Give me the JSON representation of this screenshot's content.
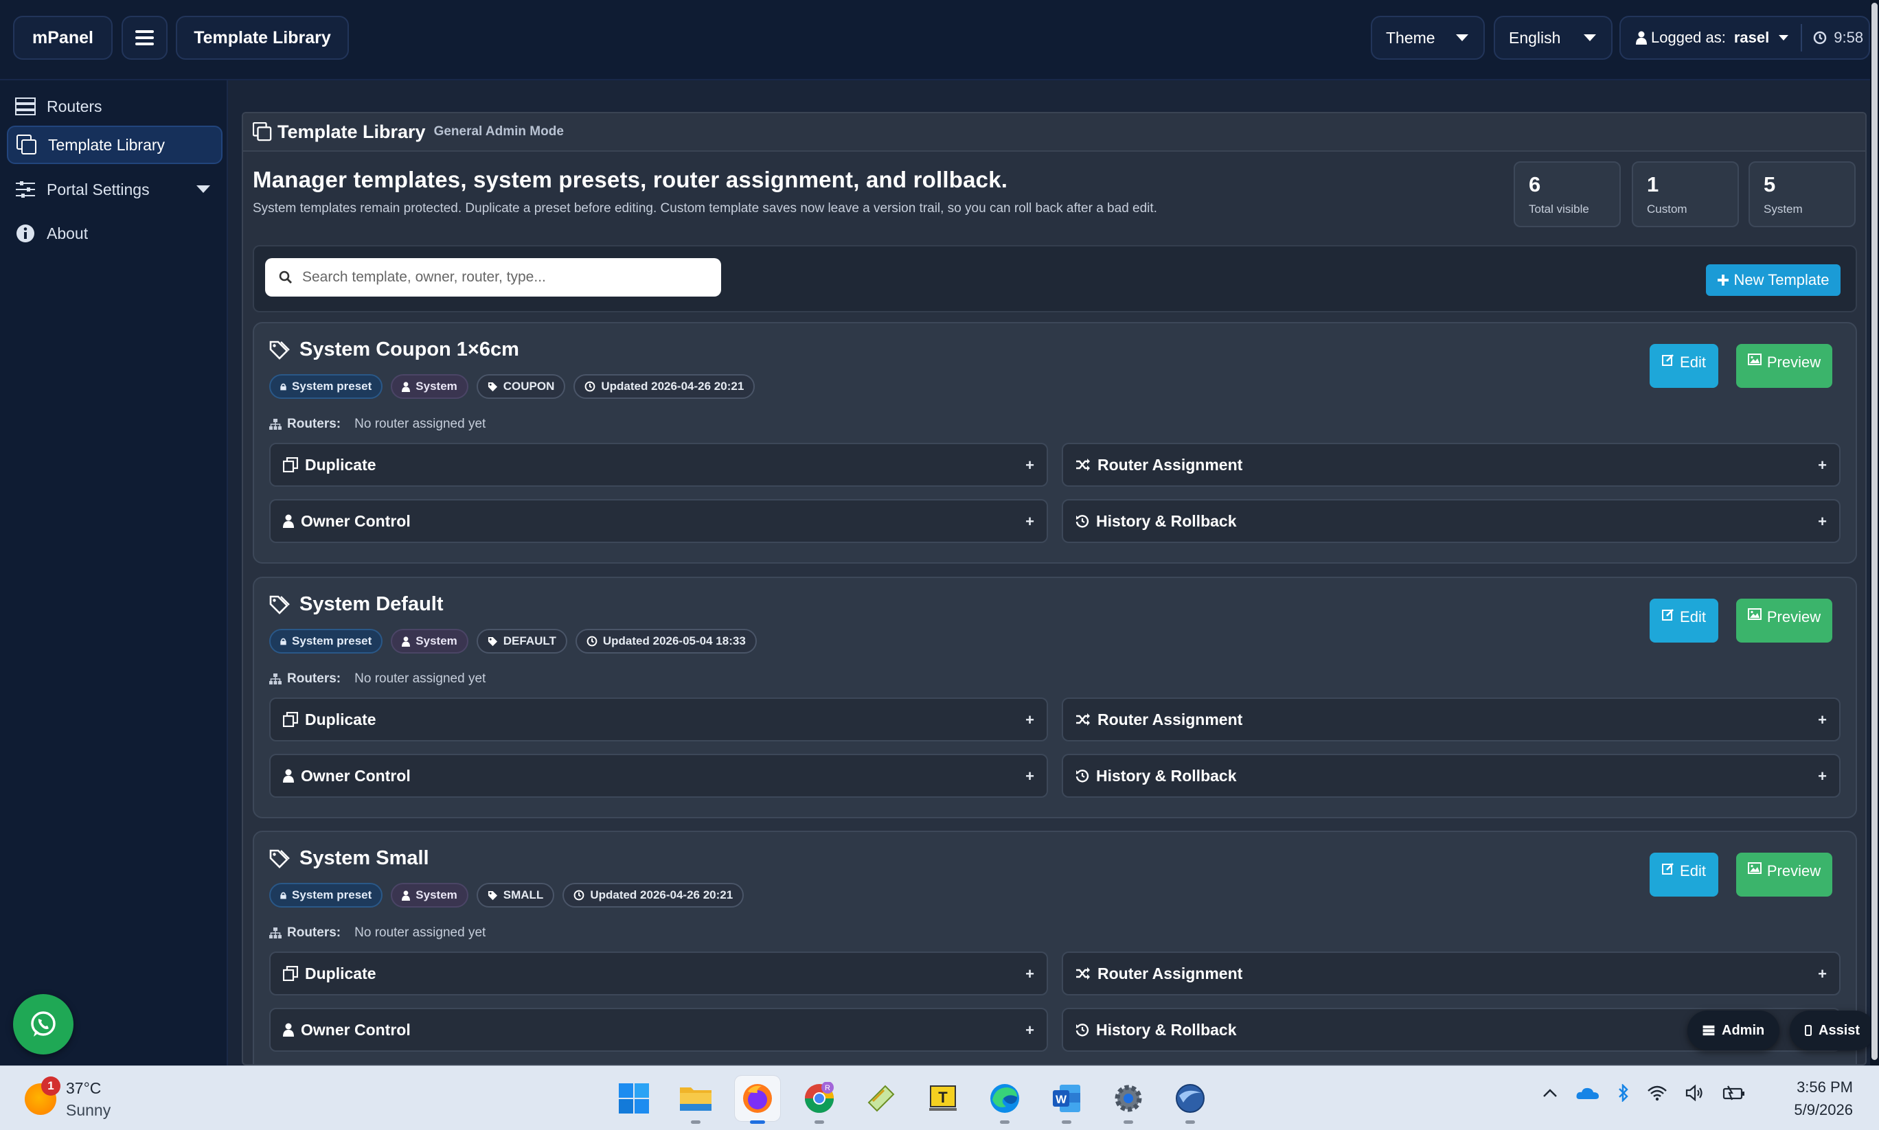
{
  "topbar": {
    "brand": "mPanel",
    "breadcrumb": "Template Library",
    "theme_label": "Theme",
    "language_label": "English",
    "logged_prefix": "Logged as:",
    "username": "rasel",
    "clock": "9:58"
  },
  "sidebar": {
    "items": [
      {
        "label": "Routers",
        "icon": "server-icon"
      },
      {
        "label": "Template Library",
        "icon": "copy-icon",
        "active": true
      },
      {
        "label": "Portal Settings",
        "icon": "sliders-icon",
        "has_submenu": true
      },
      {
        "label": "About",
        "icon": "info-icon"
      }
    ]
  },
  "main": {
    "header_title": "Template Library",
    "header_mode": "General Admin Mode",
    "heading": "Manager templates, system presets, router assignment, and rollback.",
    "description": "System templates remain protected. Duplicate a preset before editing. Custom template saves now leave a version trail, so you can roll back after a bad edit.",
    "stats": [
      {
        "value": "6",
        "label": "Total visible"
      },
      {
        "value": "1",
        "label": "Custom"
      },
      {
        "value": "5",
        "label": "System"
      }
    ],
    "search_placeholder": "Search template, owner, router, type...",
    "new_template_label": "New Template"
  },
  "templates": [
    {
      "name": "System Coupon 1×6cm",
      "badges": {
        "preset": "System preset",
        "owner": "System",
        "type": "COUPON",
        "updated": "Updated 2026-04-26 20:21"
      },
      "routers_label": "Routers:",
      "routers_value": "No router assigned yet",
      "sections": {
        "duplicate": "Duplicate",
        "router_assignment": "Router Assignment",
        "owner_control": "Owner Control",
        "history": "History & Rollback"
      },
      "edit_label": "Edit",
      "preview_label": "Preview"
    },
    {
      "name": "System Default",
      "badges": {
        "preset": "System preset",
        "owner": "System",
        "type": "DEFAULT",
        "updated": "Updated 2026-05-04 18:33"
      },
      "routers_label": "Routers:",
      "routers_value": "No router assigned yet",
      "sections": {
        "duplicate": "Duplicate",
        "router_assignment": "Router Assignment",
        "owner_control": "Owner Control",
        "history": "History & Rollback"
      },
      "edit_label": "Edit",
      "preview_label": "Preview"
    },
    {
      "name": "System Small",
      "badges": {
        "preset": "System preset",
        "owner": "System",
        "type": "SMALL",
        "updated": "Updated 2026-04-26 20:21"
      },
      "routers_label": "Routers:",
      "routers_value": "No router assigned yet",
      "sections": {
        "duplicate": "Duplicate",
        "router_assignment": "Router Assignment",
        "owner_control": "Owner Control",
        "history": "History & Rollback"
      },
      "edit_label": "Edit",
      "preview_label": "Preview"
    }
  ],
  "floating": {
    "admin_label": "Admin",
    "assist_label": "Assist"
  },
  "taskbar": {
    "weather_temp": "37°C",
    "weather_cond": "Sunny",
    "weather_badge": "1",
    "time": "3:56 PM",
    "date": "5/9/2026",
    "apps": [
      "start-icon",
      "file-explorer-icon",
      "firefox-icon",
      "chrome-icon",
      "sticky-app-icon",
      "text-app-icon",
      "edge-icon",
      "word-icon",
      "settings-icon",
      "browser-globe-icon"
    ]
  },
  "colors": {
    "page_bg": "#1a2538",
    "nav_bg": "#0f1c33",
    "card_bg": "#2f3948",
    "edit_button": "#1ea7d9",
    "preview_button": "#3bb46b",
    "new_button": "#1b9bd6",
    "whatsapp": "#1fa855"
  }
}
